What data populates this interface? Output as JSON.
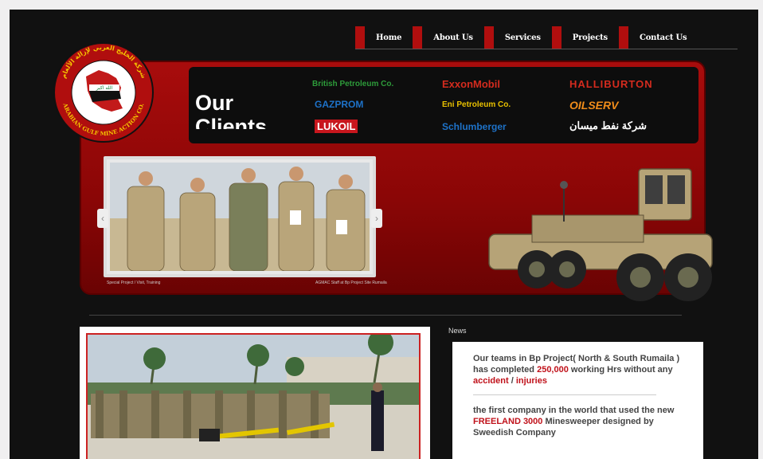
{
  "nav": {
    "items": [
      {
        "label": "Home"
      },
      {
        "label": "About Us"
      },
      {
        "label": "Services"
      },
      {
        "label": "Projects"
      },
      {
        "label": "Contact Us"
      }
    ]
  },
  "logo": {
    "text_top": "شركة الخليج العربي لإزالة الألغام",
    "text_bottom": "ARABIAN GULF MINE ACTION CO."
  },
  "clients": {
    "title": "Our Clients",
    "logos": [
      "British Petroleum Co.",
      "ExxonMobil",
      "HALLIBURTON",
      "GAZPROM",
      "Eni Petroleum Co.",
      "OILSERV",
      "LUKOIL",
      "Schlumberger",
      "شركة نفط ميسان"
    ]
  },
  "slider": {
    "caption_left": "Special Project / Visit, Training",
    "caption_right": "AGMAC Staff at Bp Project Site Rumaila"
  },
  "news": {
    "title": "News",
    "item1": {
      "part1": "Our teams in Bp Project( North & South Rumaila ) has completed ",
      "highlight1": "250,000",
      "part2": " working Hrs without any ",
      "highlight2": "accident",
      "part3": " / ",
      "highlight3": "injuries"
    },
    "item2": {
      "part1": "the first company in the world that used the new ",
      "highlight1": "FREELAND 3000",
      "part2": " Minesweeper designed by Sweedish Company"
    }
  },
  "colors": {
    "brand_red": "#b00e0e",
    "background": "#111111",
    "highlight": "#c0111a"
  }
}
